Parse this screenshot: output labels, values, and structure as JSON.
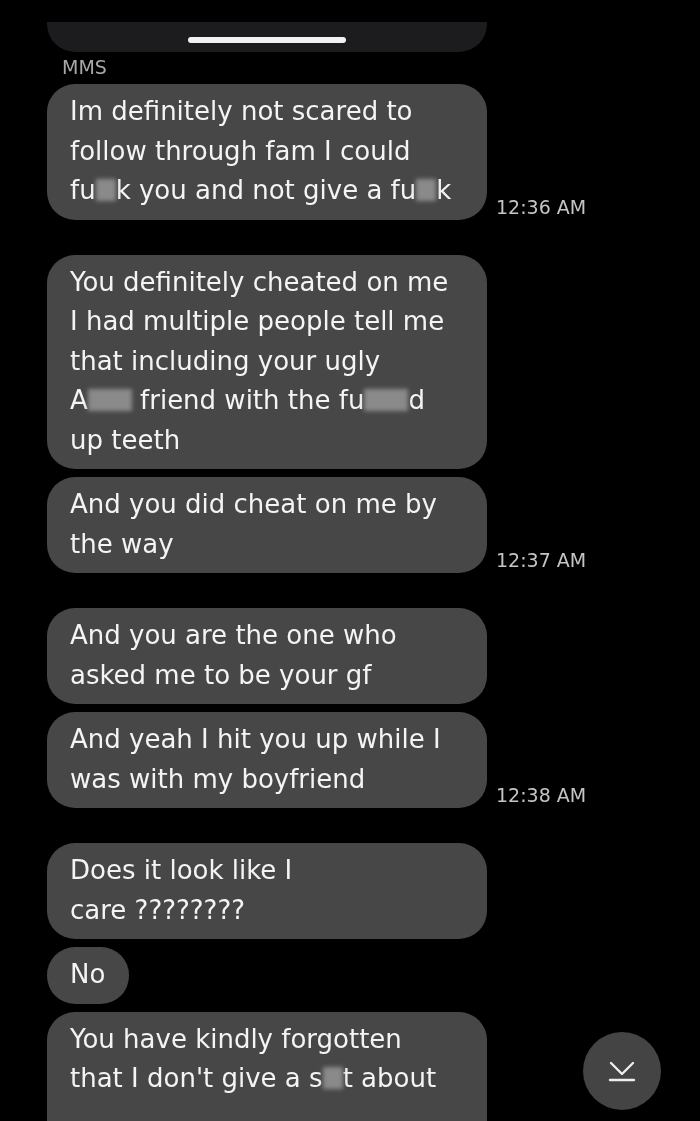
{
  "label": "MMS",
  "groups": [
    {
      "time": "12:36 AM",
      "messages": [
        {
          "lines": [
            [
              {
                "kind": "text",
                "text": "Im definitely not scared to"
              }
            ],
            [
              {
                "kind": "text",
                "text": "follow through fam I could"
              }
            ],
            [
              {
                "kind": "text",
                "text": "fu"
              },
              {
                "kind": "blur"
              },
              {
                "kind": "text",
                "text": "k you and not give a fu"
              },
              {
                "kind": "blur"
              },
              {
                "kind": "text",
                "text": "k"
              }
            ]
          ]
        }
      ]
    },
    {
      "time": "12:37 AM",
      "messages": [
        {
          "lines": [
            [
              {
                "kind": "text",
                "text": "You definitely cheated on me"
              }
            ],
            [
              {
                "kind": "text",
                "text": "I had multiple people tell me"
              }
            ],
            [
              {
                "kind": "text",
                "text": "that including your ugly"
              }
            ],
            [
              {
                "kind": "text",
                "text": "A"
              },
              {
                "kind": "blur_wide"
              },
              {
                "kind": "text",
                "text": " friend with the fu"
              },
              {
                "kind": "blur_wide"
              },
              {
                "kind": "text",
                "text": "d"
              }
            ],
            [
              {
                "kind": "text",
                "text": "up teeth"
              }
            ]
          ]
        },
        {
          "lines": [
            [
              {
                "kind": "text",
                "text": "And you did cheat on me by"
              }
            ],
            [
              {
                "kind": "text",
                "text": "the way"
              }
            ]
          ]
        }
      ]
    },
    {
      "time": "12:38 AM",
      "messages": [
        {
          "lines": [
            [
              {
                "kind": "text",
                "text": "And you are the one who"
              }
            ],
            [
              {
                "kind": "text",
                "text": "asked me to be your gf"
              }
            ]
          ]
        },
        {
          "lines": [
            [
              {
                "kind": "text",
                "text": "And yeah I hit you up while I"
              }
            ],
            [
              {
                "kind": "text",
                "text": "was with my boyfriend"
              }
            ]
          ]
        }
      ]
    },
    {
      "messages": [
        {
          "lines": [
            [
              {
                "kind": "text",
                "text": "Does it look like I"
              }
            ],
            [
              {
                "kind": "text",
                "text": "care ????????"
              }
            ]
          ]
        },
        {
          "lines": [
            [
              {
                "kind": "text",
                "text": "No"
              }
            ]
          ]
        },
        {
          "lines": [
            [
              {
                "kind": "text",
                "text": "You have kindly forgotten"
              }
            ],
            [
              {
                "kind": "text",
                "text": "that I don't give a s"
              },
              {
                "kind": "blur"
              },
              {
                "kind": "text",
                "text": "t about"
              }
            ]
          ]
        }
      ]
    }
  ]
}
